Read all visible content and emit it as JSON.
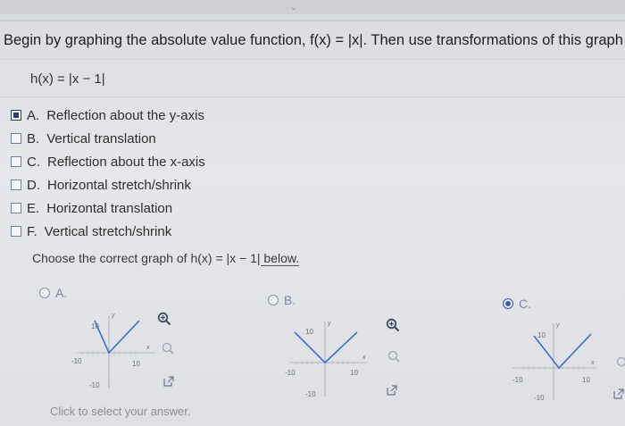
{
  "question": {
    "text": "Begin by graphing the absolute value function, f(x) = |x|. Then use transformations of this graph",
    "function": "h(x) = |x − 1|"
  },
  "transformations": [
    {
      "letter": "A.",
      "label": "Reflection about the y-axis",
      "checked": true
    },
    {
      "letter": "B.",
      "label": "Vertical translation",
      "checked": false
    },
    {
      "letter": "C.",
      "label": "Reflection about the x-axis",
      "checked": false
    },
    {
      "letter": "D.",
      "label": "Horizontal stretch/shrink",
      "checked": false
    },
    {
      "letter": "E.",
      "label": "Horizontal translation",
      "checked": false
    },
    {
      "letter": "F.",
      "label": "Vertical stretch/shrink",
      "checked": false
    }
  ],
  "graph_prompt": {
    "before": "Choose the correct graph of ",
    "func": "h(x) = |x − 1|",
    "after": " below."
  },
  "graph_choices": [
    {
      "label": "A.",
      "selected": false,
      "ticks": {
        "ymax": "10",
        "xmin": "-10",
        "xmax": "10",
        "ymin": "-10"
      },
      "axis_y": "y",
      "axis_x": "x"
    },
    {
      "label": "B.",
      "selected": false,
      "ticks": {
        "ymax": "10",
        "xmin": "-10",
        "xmax": "10",
        "ymin": "-10"
      },
      "axis_y": "y",
      "axis_x": "x"
    },
    {
      "label": "C.",
      "selected": true,
      "ticks": {
        "ymax": "10",
        "xmin": "-10",
        "xmax": "10",
        "ymin": "-10"
      },
      "axis_y": "y",
      "axis_x": "x"
    }
  ],
  "hint": "Click to select your answer.",
  "colors": {
    "curve": "#3b6fd0",
    "accent": "#3b5ba8"
  }
}
